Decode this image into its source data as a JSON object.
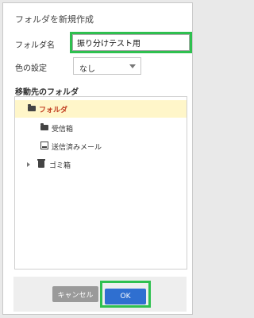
{
  "dialog": {
    "title": "フォルダを新規作成"
  },
  "form": {
    "name_label": "フォルダ名",
    "name_value": "振り分けテスト用",
    "color_label": "色の設定",
    "color_value": "なし"
  },
  "destination": {
    "title": "移動先のフォルダ",
    "items": [
      {
        "label": "フォルダ",
        "icon": "folder-icon"
      },
      {
        "label": "受信箱",
        "icon": "folder-icon"
      },
      {
        "label": "送信済みメール",
        "icon": "sent-tray-icon"
      },
      {
        "label": "ゴミ箱",
        "icon": "trash-icon"
      }
    ]
  },
  "buttons": {
    "cancel": "キャンセル",
    "ok": "OK"
  },
  "colors": {
    "highlight": "#2ec04f",
    "primary": "#2f6fd0",
    "selected_text": "#c03a1e",
    "selected_bg": "#fff6c9"
  }
}
